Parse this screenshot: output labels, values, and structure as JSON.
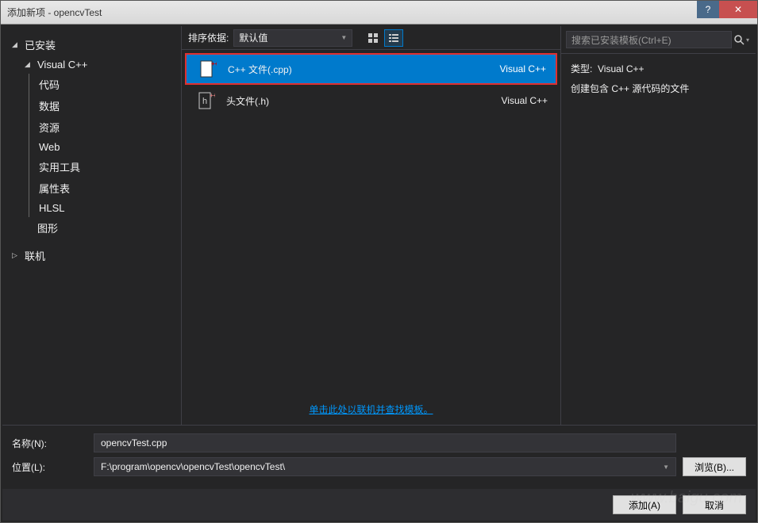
{
  "window": {
    "title": "添加新项 - opencvTest"
  },
  "sidebar": {
    "items": [
      {
        "label": "已安装",
        "arrow": "◢",
        "level": 0
      },
      {
        "label": "Visual C++",
        "arrow": "◢",
        "level": 1
      },
      {
        "label": "代码",
        "level": 2
      },
      {
        "label": "数据",
        "level": 2
      },
      {
        "label": "资源",
        "level": 2
      },
      {
        "label": "Web",
        "level": 2
      },
      {
        "label": "实用工具",
        "level": 2
      },
      {
        "label": "属性表",
        "level": 2
      },
      {
        "label": "HLSL",
        "level": 2
      },
      {
        "label": "图形",
        "level": 1
      },
      {
        "label": "联机",
        "arrow": "▷",
        "level": 0
      }
    ]
  },
  "toolbar": {
    "sort_label": "排序依据:",
    "sort_value": "默认值"
  },
  "templates": [
    {
      "name": "C++ 文件(.cpp)",
      "lang": "Visual C++",
      "selected": true
    },
    {
      "name": "头文件(.h)",
      "lang": "Visual C++",
      "selected": false
    }
  ],
  "online_link": "单击此处以联机并查找模板。",
  "search": {
    "placeholder": "搜索已安装模板(Ctrl+E)"
  },
  "details": {
    "type_label": "类型:",
    "type_value": "Visual C++",
    "description": "创建包含 C++ 源代码的文件"
  },
  "form": {
    "name_label": "名称(N):",
    "name_value": "opencvTest.cpp",
    "location_label": "位置(L):",
    "location_value": "F:\\program\\opencv\\opencvTest\\opencvTest\\",
    "browse_label": "浏览(B)..."
  },
  "buttons": {
    "add": "添加(A)",
    "cancel": "取消"
  },
  "watermark": "www.baigu.com"
}
